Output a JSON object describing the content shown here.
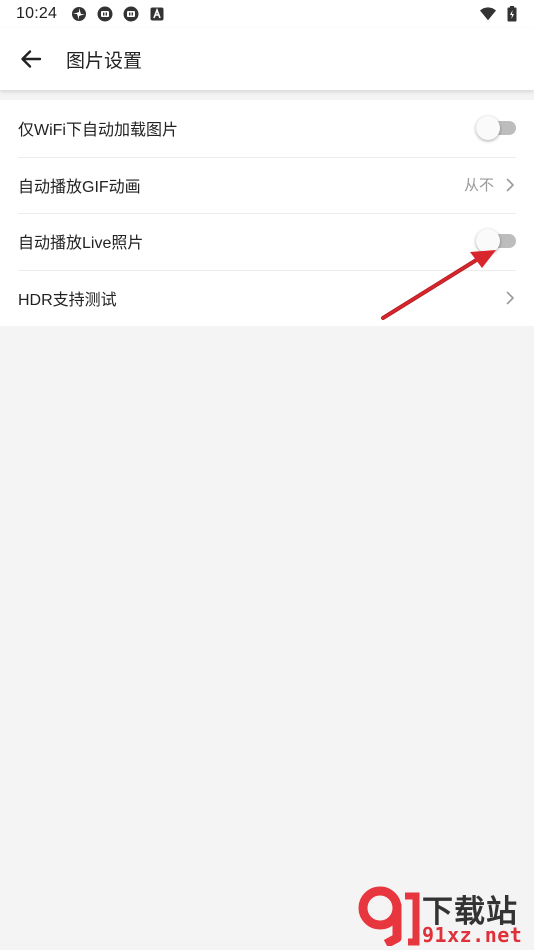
{
  "status_bar": {
    "time": "10:24",
    "left_icons": [
      "pinwheel-icon",
      "app-badge-icon",
      "app-badge-icon",
      "a-badge-icon"
    ],
    "right_icons": [
      "wifi-icon",
      "battery-icon"
    ]
  },
  "header": {
    "title": "图片设置",
    "back_icon": "arrow-left-icon"
  },
  "settings": {
    "items": [
      {
        "label": "仅WiFi下自动加载图片",
        "control": "toggle",
        "on": false
      },
      {
        "label": "自动播放GIF动画",
        "control": "value-chevron",
        "value": "从不"
      },
      {
        "label": "自动播放Live照片",
        "control": "toggle",
        "on": false
      },
      {
        "label": "HDR支持测试",
        "control": "chevron"
      }
    ]
  },
  "watermark": {
    "logo_text": "下载站",
    "url": "91xz.net"
  },
  "colors": {
    "background": "#f4f4f4",
    "surface": "#ffffff",
    "toggle_track_off": "#bdbdbd",
    "annotation_arrow": "#d8262c",
    "watermark_red": "#e0303a"
  }
}
